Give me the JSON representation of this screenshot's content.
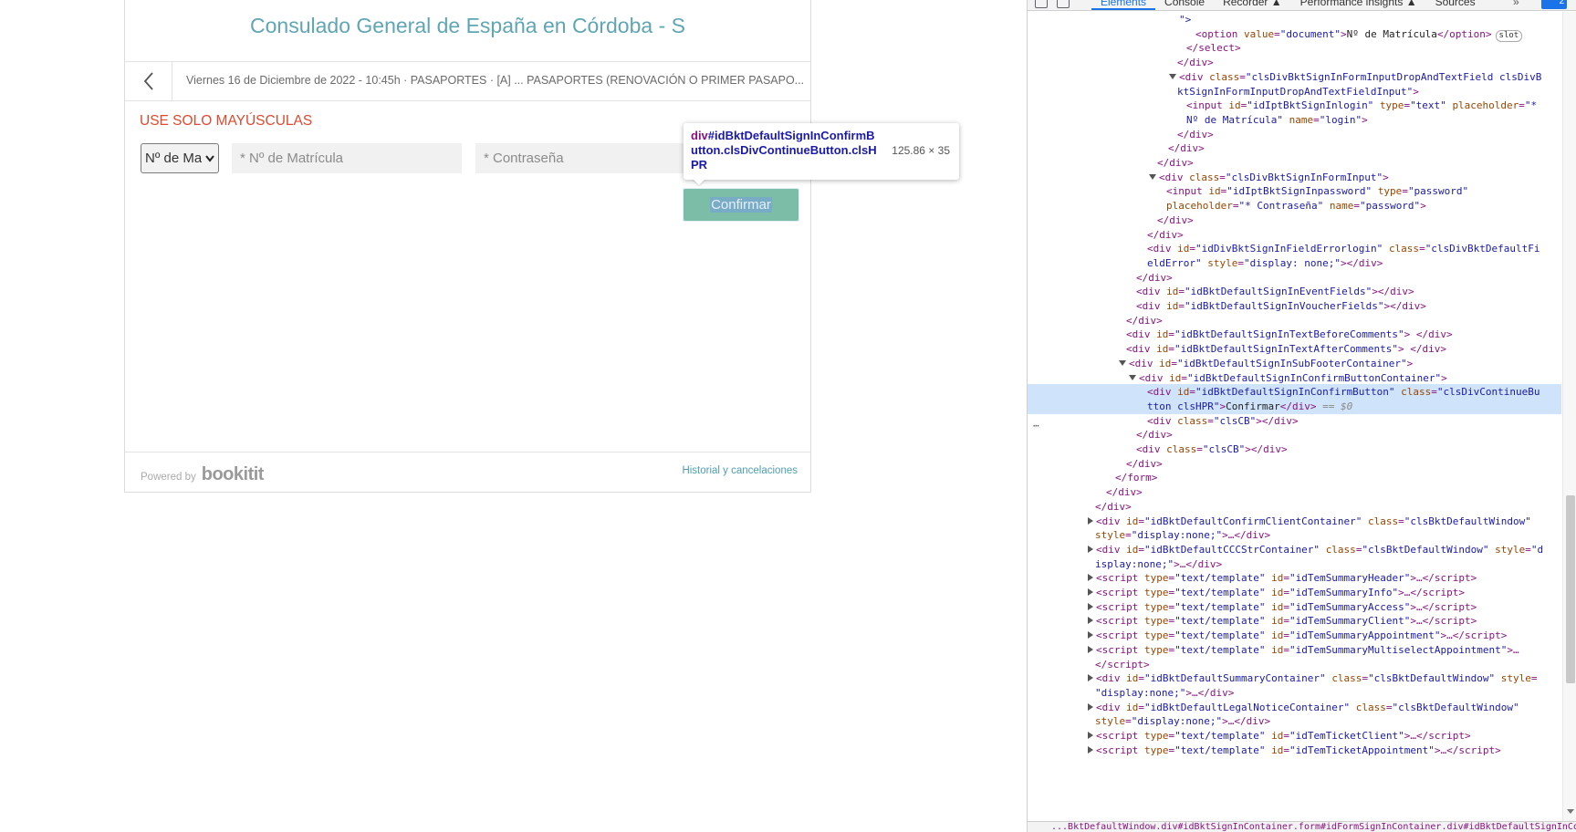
{
  "page": {
    "title": "Consulado General de España en Córdoba - S",
    "info": "Viernes 16 de Diciembre de 2022 - 10:45h · PASAPORTES · [A] ... PASAPORTES (RENOVACIÓN O PRIMER PASAPO...",
    "warning": "USE SOLO MAYÚSCULAS",
    "doc_select_value": "Nº de Matrícula",
    "login_placeholder": "* Nº de Matrícula",
    "password_placeholder": "* Contraseña",
    "confirm_label": "Confirmar",
    "powered_by": "Powered by",
    "brand": "bookitit",
    "history_link": "Historial y cancelaciones",
    "colors": {
      "title": "#5fa6b4",
      "warning": "#e0492f",
      "button": "#7ec39a",
      "link": "#4f9eae"
    }
  },
  "tooltip": {
    "tag": "div",
    "selector": "#idBktDefaultSignInConfirmButton.clsDivContinueButton.clsHPR",
    "dimensions": "125.86 × 35"
  },
  "devtools": {
    "tabs": [
      "Elements",
      "Console",
      "Recorder ▲",
      "Performance insights ▲",
      "Sources"
    ],
    "active_tab": "Elements",
    "more": "»",
    "badge": "2",
    "breadcrumb": "...BktDefaultWindow.div#idBktSignInContainer.form#idFormSignInContainer.div#idBktDefaultSignInContent..."
  },
  "dom_lines": [
    {
      "indent": 166,
      "html": "<span class=\"av\">\"></span>"
    },
    {
      "indent": 184,
      "html": "<span class=\"t\">&lt;option </span><span class=\"an\">value</span><span class=\"t\">=</span><span class=\"av\">\"document\"</span><span class=\"t\">&gt;</span><span class=\"tx\">Nº de Matrícula</span><span class=\"t\">&lt;/option&gt;</span><span class=\"slot-badge\">slot</span>"
    },
    {
      "indent": 174,
      "html": "<span class=\"t\">&lt;/select&gt;</span>"
    },
    {
      "indent": 164,
      "html": "<span class=\"t\">&lt;/div&gt;</span>"
    },
    {
      "indent": 155,
      "tri": "d",
      "html": "<span class=\"t\">&lt;div </span><span class=\"an\">class</span><span class=\"t\">=</span><span class=\"av\">\"clsDivBktSignInFormInputDropAndTextField clsDivB</span>"
    },
    {
      "indent": 164,
      "html": "<span class=\"av\">ktSignInFormInputDropAndTextFieldInput\"</span><span class=\"t\">&gt;</span>"
    },
    {
      "indent": 174,
      "html": "<span class=\"t\">&lt;input </span><span class=\"an\">id</span><span class=\"t\">=</span><span class=\"av\">\"idIptBktSignInlogin\"</span><span class=\"t\"> </span><span class=\"an\">type</span><span class=\"t\">=</span><span class=\"av\">\"text\"</span><span class=\"t\"> </span><span class=\"an\">placeholder</span><span class=\"t\">=</span><span class=\"av\">\"*</span>"
    },
    {
      "indent": 174,
      "html": "<span class=\"av\">Nº de Matrícula\"</span><span class=\"t\"> </span><span class=\"an\">name</span><span class=\"t\">=</span><span class=\"av\">\"login\"</span><span class=\"t\">&gt;</span>"
    },
    {
      "indent": 164,
      "html": "<span class=\"t\">&lt;/div&gt;</span>"
    },
    {
      "indent": 154,
      "html": "<span class=\"t\">&lt;/div&gt;</span>"
    },
    {
      "indent": 142,
      "html": "<span class=\"t\">&lt;/div&gt;</span>"
    },
    {
      "indent": 133,
      "tri": "d",
      "html": "<span class=\"t\">&lt;div </span><span class=\"an\">class</span><span class=\"t\">=</span><span class=\"av\">\"clsDivBktSignInFormInput\"</span><span class=\"t\">&gt;</span>"
    },
    {
      "indent": 152,
      "html": "<span class=\"t\">&lt;input </span><span class=\"an\">id</span><span class=\"t\">=</span><span class=\"av\">\"idIptBktSignInpassword\"</span><span class=\"t\"> </span><span class=\"an\">type</span><span class=\"t\">=</span><span class=\"av\">\"password\"</span>"
    },
    {
      "indent": 152,
      "html": "<span class=\"an\">placeholder</span><span class=\"t\">=</span><span class=\"av\">\"* Contraseña\"</span><span class=\"t\"> </span><span class=\"an\">name</span><span class=\"t\">=</span><span class=\"av\">\"password\"</span><span class=\"t\">&gt;</span>"
    },
    {
      "indent": 142,
      "html": "<span class=\"t\">&lt;/div&gt;</span>"
    },
    {
      "indent": 131,
      "html": "<span class=\"t\">&lt;/div&gt;</span>"
    },
    {
      "indent": 131,
      "html": "<span class=\"t\">&lt;div </span><span class=\"an\">id</span><span class=\"t\">=</span><span class=\"av\">\"idDivBktSignInFieldErrorlogin\"</span><span class=\"t\"> </span><span class=\"an\">class</span><span class=\"t\">=</span><span class=\"av\">\"clsDivBktDefaultFi</span>"
    },
    {
      "indent": 131,
      "html": "<span class=\"av\">eldError\"</span><span class=\"t\"> </span><span class=\"an\">style</span><span class=\"t\">=</span><span class=\"av\">\"display: none;\"</span><span class=\"t\">&gt;&lt;/div&gt;</span>"
    },
    {
      "indent": 119,
      "html": "<span class=\"t\">&lt;/div&gt;</span>"
    },
    {
      "indent": 119,
      "html": "<span class=\"t\">&lt;div </span><span class=\"an\">id</span><span class=\"t\">=</span><span class=\"av\">\"idBktDefaultSignInEventFields\"</span><span class=\"t\">&gt;&lt;/div&gt;</span>"
    },
    {
      "indent": 119,
      "html": "<span class=\"t\">&lt;div </span><span class=\"an\">id</span><span class=\"t\">=</span><span class=\"av\">\"idBktDefaultSignInVoucherFields\"</span><span class=\"t\">&gt;&lt;/div&gt;</span>"
    },
    {
      "indent": 108,
      "html": "<span class=\"t\">&lt;/div&gt;</span>"
    },
    {
      "indent": 108,
      "html": "<span class=\"t\">&lt;div </span><span class=\"an\">id</span><span class=\"t\">=</span><span class=\"av\">\"idBktDefaultSignInTextBeforeComments\"</span><span class=\"t\">&gt; &lt;/div&gt;</span>"
    },
    {
      "indent": 108,
      "html": "<span class=\"t\">&lt;div </span><span class=\"an\">id</span><span class=\"t\">=</span><span class=\"av\">\"idBktDefaultSignInTextAfterComments\"</span><span class=\"t\">&gt; &lt;/div&gt;</span>"
    },
    {
      "indent": 100,
      "tri": "d",
      "html": "<span class=\"t\">&lt;div </span><span class=\"an\">id</span><span class=\"t\">=</span><span class=\"av\">\"idBktDefaultSignInSubFooterContainer\"</span><span class=\"t\">&gt;</span>"
    },
    {
      "indent": 111,
      "tri": "d",
      "html": "<span class=\"t\">&lt;div </span><span class=\"an\">id</span><span class=\"t\">=</span><span class=\"av\">\"idBktDefaultSignInConfirmButtonContainer\"</span><span class=\"t\">&gt;</span>"
    },
    {
      "indent": 131,
      "selected": true,
      "html": "<span class=\"t\">&lt;div </span><span class=\"an\">id</span><span class=\"t\">=</span><span class=\"av\">\"idBktDefaultSignInConfirmButton\"</span><span class=\"t\"> </span><span class=\"an\">class</span><span class=\"t\">=</span><span class=\"av\">\"clsDivContinueBu</span>"
    },
    {
      "indent": 131,
      "selected": true,
      "html": "<span class=\"av\">tton clsHPR\"</span><span class=\"t\">&gt;</span><span class=\"tx\">Confirmar</span><span class=\"t\">&lt;/div&gt;</span><span class=\"eq\"> == $0</span>"
    },
    {
      "indent": 131,
      "html": "<span class=\"t\">&lt;div </span><span class=\"an\">class</span><span class=\"t\">=</span><span class=\"av\">\"clsCB\"</span><span class=\"t\">&gt;&lt;/div&gt;</span>"
    },
    {
      "indent": 119,
      "html": "<span class=\"t\">&lt;/div&gt;</span>"
    },
    {
      "indent": 119,
      "html": "<span class=\"t\">&lt;div </span><span class=\"an\">class</span><span class=\"t\">=</span><span class=\"av\">\"clsCB\"</span><span class=\"t\">&gt;&lt;/div&gt;</span>"
    },
    {
      "indent": 108,
      "html": "<span class=\"t\">&lt;/div&gt;</span>"
    },
    {
      "indent": 96,
      "html": "<span class=\"t\">&lt;/form&gt;</span>"
    },
    {
      "indent": 86,
      "html": "<span class=\"t\">&lt;/div&gt;</span>"
    },
    {
      "indent": 74,
      "html": "<span class=\"t\">&lt;/div&gt;</span>"
    },
    {
      "indent": 66,
      "tri": "r",
      "html": "<span class=\"t\">&lt;div </span><span class=\"an\">id</span><span class=\"t\">=</span><span class=\"av\">\"idBktDefaultConfirmClientContainer\"</span><span class=\"t\"> </span><span class=\"an\">class</span><span class=\"t\">=</span><span class=\"av\">\"clsBktDefaultWindow\"</span>"
    },
    {
      "indent": 74,
      "html": "<span class=\"an\">style</span><span class=\"t\">=</span><span class=\"av\">\"display:none;\"</span><span class=\"t\">&gt;…&lt;/div&gt;</span>"
    },
    {
      "indent": 66,
      "tri": "r",
      "html": "<span class=\"t\">&lt;div </span><span class=\"an\">id</span><span class=\"t\">=</span><span class=\"av\">\"idBktDefaultCCCStrContainer\"</span><span class=\"t\"> </span><span class=\"an\">class</span><span class=\"t\">=</span><span class=\"av\">\"clsBktDefaultWindow\"</span><span class=\"t\"> </span><span class=\"an\">style</span><span class=\"t\">=</span><span class=\"av\">\"d</span>"
    },
    {
      "indent": 74,
      "html": "<span class=\"av\">isplay:none;\"</span><span class=\"t\">&gt;…&lt;/div&gt;</span>"
    },
    {
      "indent": 66,
      "tri": "r",
      "html": "<span class=\"t\">&lt;script </span><span class=\"an\">type</span><span class=\"t\">=</span><span class=\"av\">\"text/template\"</span><span class=\"t\"> </span><span class=\"an\">id</span><span class=\"t\">=</span><span class=\"av\">\"idTemSummaryHeader\"</span><span class=\"t\">&gt;…&lt;/script&gt;</span>"
    },
    {
      "indent": 66,
      "tri": "r",
      "html": "<span class=\"t\">&lt;script </span><span class=\"an\">type</span><span class=\"t\">=</span><span class=\"av\">\"text/template\"</span><span class=\"t\"> </span><span class=\"an\">id</span><span class=\"t\">=</span><span class=\"av\">\"idTemSummaryInfo\"</span><span class=\"t\">&gt;…&lt;/script&gt;</span>"
    },
    {
      "indent": 66,
      "tri": "r",
      "html": "<span class=\"t\">&lt;script </span><span class=\"an\">type</span><span class=\"t\">=</span><span class=\"av\">\"text/template\"</span><span class=\"t\"> </span><span class=\"an\">id</span><span class=\"t\">=</span><span class=\"av\">\"idTemSummaryAccess\"</span><span class=\"t\">&gt;…&lt;/script&gt;</span>"
    },
    {
      "indent": 66,
      "tri": "r",
      "html": "<span class=\"t\">&lt;script </span><span class=\"an\">type</span><span class=\"t\">=</span><span class=\"av\">\"text/template\"</span><span class=\"t\"> </span><span class=\"an\">id</span><span class=\"t\">=</span><span class=\"av\">\"idTemSummaryClient\"</span><span class=\"t\">&gt;…&lt;/script&gt;</span>"
    },
    {
      "indent": 66,
      "tri": "r",
      "html": "<span class=\"t\">&lt;script </span><span class=\"an\">type</span><span class=\"t\">=</span><span class=\"av\">\"text/template\"</span><span class=\"t\"> </span><span class=\"an\">id</span><span class=\"t\">=</span><span class=\"av\">\"idTemSummaryAppointment\"</span><span class=\"t\">&gt;…&lt;/script&gt;</span>"
    },
    {
      "indent": 66,
      "tri": "r",
      "html": "<span class=\"t\">&lt;script </span><span class=\"an\">type</span><span class=\"t\">=</span><span class=\"av\">\"text/template\"</span><span class=\"t\"> </span><span class=\"an\">id</span><span class=\"t\">=</span><span class=\"av\">\"idTemSummaryMultiselectAppointment\"</span><span class=\"t\">&gt;…</span>"
    },
    {
      "indent": 74,
      "html": "<span class=\"t\">&lt;/script&gt;</span>"
    },
    {
      "indent": 66,
      "tri": "r",
      "html": "<span class=\"t\">&lt;div </span><span class=\"an\">id</span><span class=\"t\">=</span><span class=\"av\">\"idBktDefaultSummaryContainer\"</span><span class=\"t\"> </span><span class=\"an\">class</span><span class=\"t\">=</span><span class=\"av\">\"clsBktDefaultWindow\"</span><span class=\"t\"> </span><span class=\"an\">style</span><span class=\"t\">=</span>"
    },
    {
      "indent": 74,
      "html": "<span class=\"av\">\"display:none;\"</span><span class=\"t\">&gt;…&lt;/div&gt;</span>"
    },
    {
      "indent": 66,
      "tri": "r",
      "html": "<span class=\"t\">&lt;div </span><span class=\"an\">id</span><span class=\"t\">=</span><span class=\"av\">\"idBktDefaultLegalNoticeContainer\"</span><span class=\"t\"> </span><span class=\"an\">class</span><span class=\"t\">=</span><span class=\"av\">\"clsBktDefaultWindow\"</span>"
    },
    {
      "indent": 74,
      "html": "<span class=\"an\">style</span><span class=\"t\">=</span><span class=\"av\">\"display:none;\"</span><span class=\"t\">&gt;…&lt;/div&gt;</span>"
    },
    {
      "indent": 66,
      "tri": "r",
      "html": "<span class=\"t\">&lt;script </span><span class=\"an\">type</span><span class=\"t\">=</span><span class=\"av\">\"text/template\"</span><span class=\"t\"> </span><span class=\"an\">id</span><span class=\"t\">=</span><span class=\"av\">\"idTemTicketClient\"</span><span class=\"t\">&gt;…&lt;/script&gt;</span>"
    },
    {
      "indent": 66,
      "tri": "r",
      "html": "<span class=\"t\">&lt;script </span><span class=\"an\">type</span><span class=\"t\">=</span><span class=\"av\">\"text/template\"</span><span class=\"t\"> </span><span class=\"an\">id</span><span class=\"t\">=</span><span class=\"av\">\"idTemTicketAppointment\"</span><span class=\"t\">&gt;…&lt;/script&gt;</span>"
    }
  ]
}
